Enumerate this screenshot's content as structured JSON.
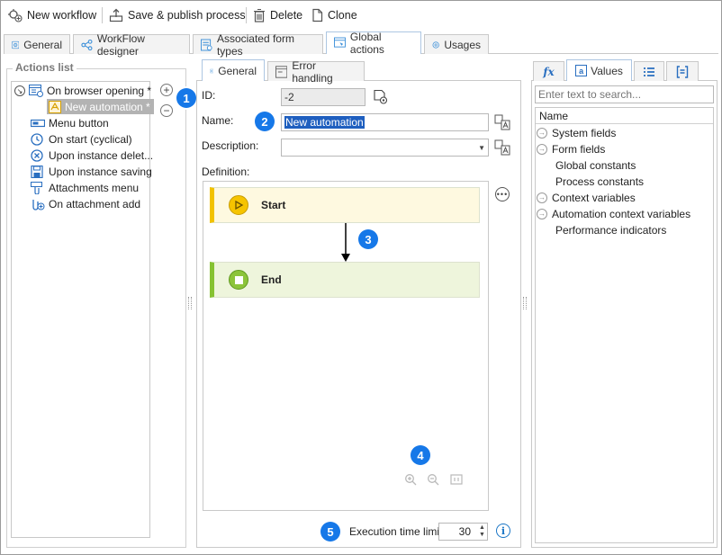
{
  "toolbar": {
    "new_workflow": "New workflow",
    "save_publish": "Save & publish process",
    "delete": "Delete",
    "clone": "Clone"
  },
  "top_tabs": [
    "General",
    "WorkFlow designer",
    "Associated form types",
    "Global actions",
    "Usages"
  ],
  "top_tabs_active": "Global actions",
  "actions_list": {
    "title": "Actions list",
    "items": [
      "On browser opening *",
      "New automation *",
      "Menu button",
      "On start (cyclical)",
      "Upon instance delet...",
      "Upon instance saving",
      "Attachments menu",
      "On attachment add"
    ],
    "selected": "New automation *",
    "add_glyph": "+",
    "remove_glyph": "−"
  },
  "inner_tabs": [
    "General",
    "Error handling"
  ],
  "inner_tabs_active": "General",
  "form": {
    "id_label": "ID:",
    "id_value": "-2",
    "name_label": "Name:",
    "name_value": "New automation",
    "description_label": "Description:",
    "description_value": "",
    "definition_label": "Definition:"
  },
  "diagram": {
    "start_label": "Start",
    "end_label": "End",
    "start_color": "#fef9e0",
    "start_accent": "#f2c200",
    "end_color": "#eef5dc",
    "end_accent": "#86c232"
  },
  "execution": {
    "label": "Execution time limit:",
    "value": "30"
  },
  "right_panel": {
    "tabs": [
      "fx",
      "Values",
      "list",
      "bracket"
    ],
    "active_tab": "Values",
    "search_placeholder": "Enter text to search...",
    "column_header": "Name",
    "items": [
      {
        "label": "System fields",
        "expandable": true
      },
      {
        "label": "Form fields",
        "expandable": true
      },
      {
        "label": "Global constants",
        "expandable": false
      },
      {
        "label": "Process constants",
        "expandable": false
      },
      {
        "label": "Context variables",
        "expandable": true
      },
      {
        "label": "Automation context variables",
        "expandable": true
      },
      {
        "label": "Performance indicators",
        "expandable": false
      }
    ]
  },
  "badges": [
    "1",
    "2",
    "3",
    "4",
    "5"
  ],
  "colors": {
    "accent": "#1678e8",
    "selection": "#1f5fbf",
    "tab_border": "#adc6e2"
  }
}
